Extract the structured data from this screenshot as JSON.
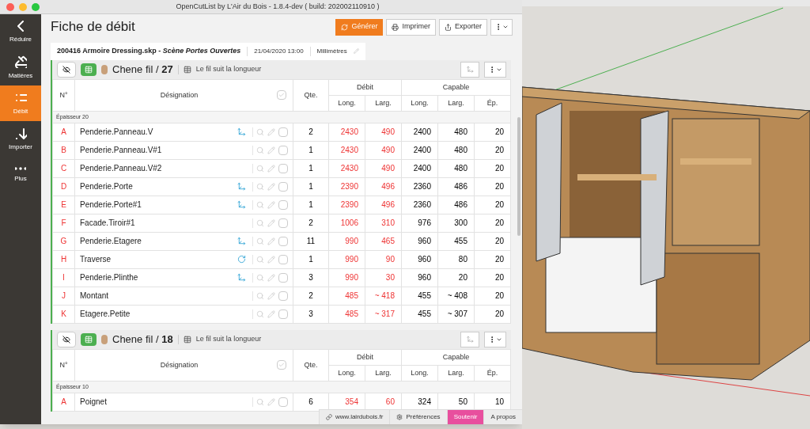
{
  "window": {
    "title": "OpenCutList by L'Air du Bois - 1.8.4-dev ( build: 202002110910 )"
  },
  "sidebar": {
    "items": [
      {
        "label": "Réduire",
        "selected": false
      },
      {
        "label": "Matières",
        "selected": false
      },
      {
        "label": "Débit",
        "selected": true
      },
      {
        "label": "Importer",
        "selected": false
      },
      {
        "label": "Plus",
        "selected": false
      }
    ]
  },
  "header": {
    "title": "Fiche de débit",
    "buttons": [
      {
        "label": "Générer",
        "kind": "primary"
      },
      {
        "label": "Imprimer",
        "kind": "print"
      },
      {
        "label": "Exporter",
        "kind": "export"
      }
    ]
  },
  "info": {
    "file": "200416 Armoire Dressing.skp - ",
    "scene": "Scène Portes Ouvertes",
    "date": "21/04/2020 13:00",
    "units": "Millimètres"
  },
  "groups": [
    {
      "material": "Chene fil / ",
      "count": "27",
      "grain": "Le fil suit la longueur",
      "columns": {
        "number": "N°",
        "designation": "Désignation",
        "qty": "Qte.",
        "debit": "Débit",
        "capable": "Capable",
        "long": "Long.",
        "larg": "Larg.",
        "long2": "Long.",
        "larg2": "Larg.",
        "ep": "Ép."
      },
      "all_checked": false,
      "thickness": "Épaisseur 20",
      "rows": [
        {
          "letter": "A",
          "name": "Penderie.Panneau.V",
          "axes_flipped": true,
          "checked": false,
          "qty": "2",
          "dl": "2430",
          "dw": "490",
          "cl": "2400",
          "cw": "480",
          "ep": "20"
        },
        {
          "letter": "B",
          "name": "Penderie.Panneau.V#1",
          "checked": false,
          "qty": "1",
          "dl": "2430",
          "dw": "490",
          "cl": "2400",
          "cw": "480",
          "ep": "20"
        },
        {
          "letter": "C",
          "name": "Penderie.Panneau.V#2",
          "checked": false,
          "qty": "1",
          "dl": "2430",
          "dw": "490",
          "cl": "2400",
          "cw": "480",
          "ep": "20"
        },
        {
          "letter": "D",
          "name": "Penderie.Porte",
          "axes_flipped": true,
          "checked": false,
          "qty": "1",
          "dl": "2390",
          "dw": "496",
          "cl": "2360",
          "cw": "486",
          "ep": "20"
        },
        {
          "letter": "E",
          "name": "Penderie.Porte#1",
          "axes_flipped": true,
          "checked": false,
          "qty": "1",
          "dl": "2390",
          "dw": "496",
          "cl": "2360",
          "cw": "486",
          "ep": "20"
        },
        {
          "letter": "F",
          "name": "Facade.Tiroir#1",
          "checked": false,
          "qty": "2",
          "dl": "1006",
          "dw": "310",
          "cl": "976",
          "cw": "300",
          "ep": "20"
        },
        {
          "letter": "G",
          "name": "Penderie.Etagere",
          "axes_flipped": true,
          "checked": false,
          "qty": "11",
          "dl": "990",
          "dw": "465",
          "cl": "960",
          "cw": "455",
          "ep": "20"
        },
        {
          "letter": "H",
          "name": "Traverse",
          "rotated": true,
          "checked": false,
          "qty": "1",
          "dl": "990",
          "dw": "90",
          "cl": "960",
          "cw": "80",
          "ep": "20"
        },
        {
          "letter": "I",
          "name": "Penderie.Plinthe",
          "axes_flipped": true,
          "checked": false,
          "qty": "3",
          "dl": "990",
          "dw": "30",
          "cl": "960",
          "cw": "20",
          "ep": "20"
        },
        {
          "letter": "J",
          "name": "Montant",
          "checked": false,
          "qty": "2",
          "dl": "485",
          "dw": "~ 418",
          "cl": "455",
          "cw": "~ 408",
          "ep": "20"
        },
        {
          "letter": "K",
          "name": "Etagere.Petite",
          "checked": false,
          "qty": "3",
          "dl": "485",
          "dw": "~ 317",
          "cl": "455",
          "cw": "~ 307",
          "ep": "20"
        }
      ]
    },
    {
      "material": "Chene fil / ",
      "count": "18",
      "grain": "Le fil suit la longueur",
      "columns": {
        "number": "N°",
        "designation": "Désignation",
        "qty": "Qte.",
        "debit": "Débit",
        "capable": "Capable",
        "long": "Long.",
        "larg": "Larg.",
        "long2": "Long.",
        "larg2": "Larg.",
        "ep": "Ép."
      },
      "all_checked": false,
      "thickness": "Épaisseur 10",
      "rows": [
        {
          "letter": "A",
          "name": "Poignet",
          "checked": false,
          "qty": "6",
          "dl": "354",
          "dw": "60",
          "cl": "324",
          "cw": "50",
          "ep": "10"
        }
      ]
    }
  ],
  "footer": [
    {
      "label": "www.lairdubois.fr",
      "kind": "link"
    },
    {
      "label": "Préférences",
      "kind": "gear"
    },
    {
      "label": "Soutenir",
      "kind": "support"
    },
    {
      "label": "A propos",
      "kind": "plain"
    }
  ]
}
